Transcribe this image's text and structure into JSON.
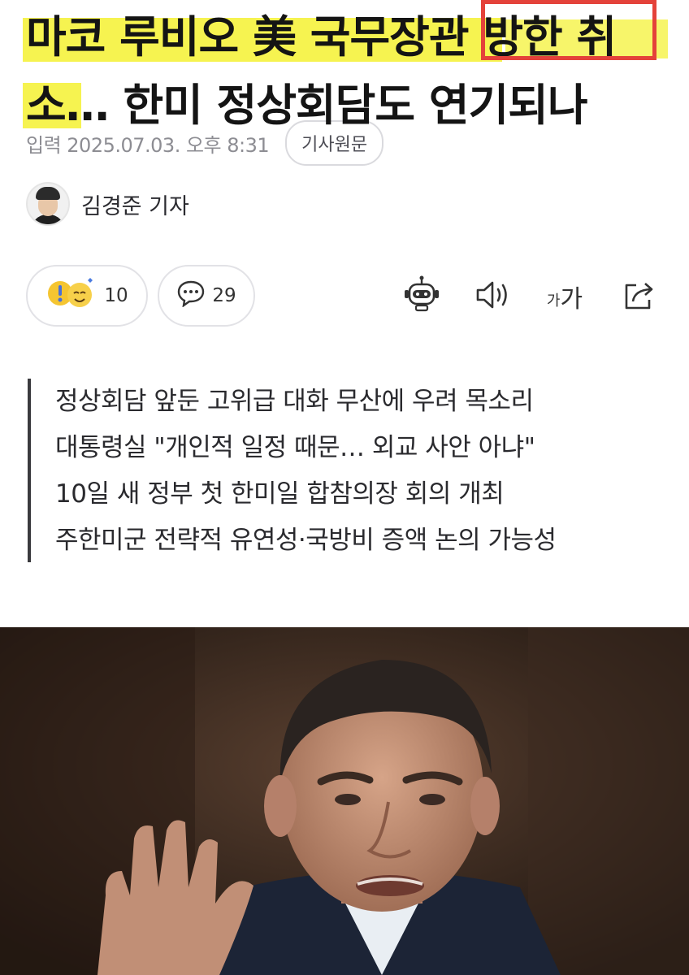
{
  "headline": {
    "line1": "마코 루비오 美 국무장관 방한 취",
    "line2": "소… 한미 정상회담도 연기되나"
  },
  "meta": {
    "date": "입력 2025.07.03. 오후 8:31",
    "original_button": "기사원문"
  },
  "author": {
    "name": "김경준 기자"
  },
  "actions": {
    "reactions_count": "10",
    "comments_count": "29",
    "font_small": "가",
    "font_large": "가"
  },
  "summary": {
    "lines": [
      "정상회담 앞둔 고위급 대화 무산에 우려 목소리",
      "대통령실 \"개인적 일정 때문… 외교 사안 아냐\"",
      "10일 새 정부 첫 한미일 합참의장 회의 개최",
      "주한미군 전략적 유연성·국방비 증액 논의 가능성"
    ]
  },
  "colors": {
    "highlighter": "#f6f350",
    "annotation_box": "#e4423a",
    "text": "#141414",
    "muted": "#8d8d93"
  },
  "icons": [
    "emoji-reaction-icon",
    "comment-icon",
    "ai-summary-robot-icon",
    "speaker-icon",
    "font-size-icon",
    "share-icon"
  ]
}
